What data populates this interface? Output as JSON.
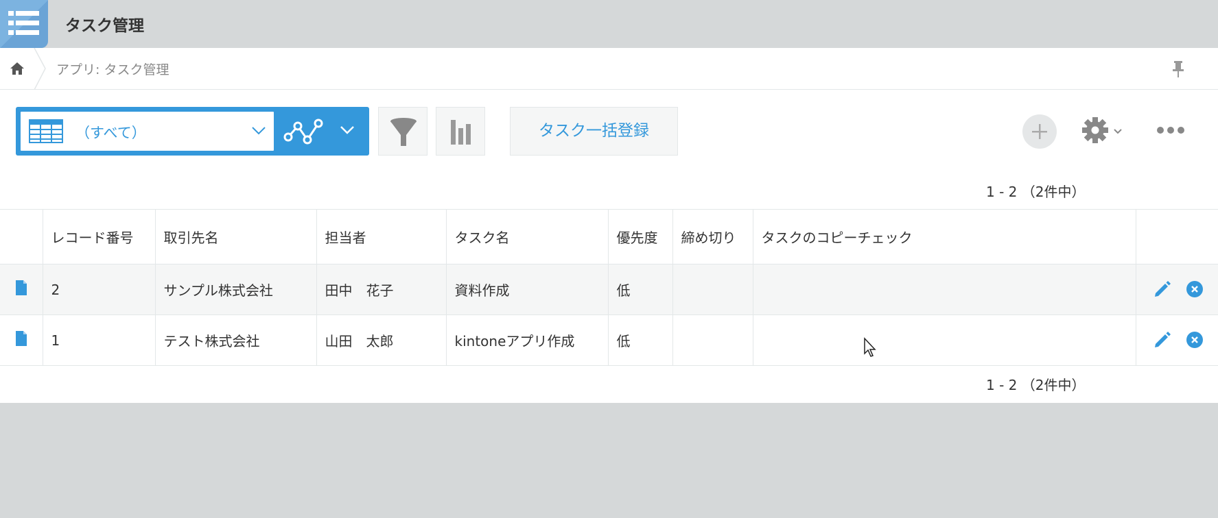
{
  "header": {
    "app_title": "タスク管理",
    "app_icon": "list-icon"
  },
  "breadcrumb": {
    "home_icon": "home-icon",
    "text": "アプリ: タスク管理",
    "pin_icon": "pin-icon"
  },
  "toolbar": {
    "view_label": "（すべて）",
    "view_icon": "table-view-icon",
    "graph_icon": "line-graph-icon",
    "filter_icon": "filter-icon",
    "chart_icon": "bar-chart-icon",
    "bulk_button": "タスク一括登録",
    "add_icon": "plus-icon",
    "settings_icon": "gear-icon",
    "more_icon": "more-dots-icon"
  },
  "pager": {
    "top": "1 - 2 （2件中）",
    "bottom": "1 - 2 （2件中）"
  },
  "table": {
    "columns": [
      "レコード番号",
      "取引先名",
      "担当者",
      "タスク名",
      "優先度",
      "締め切り",
      "タスクのコピーチェック"
    ],
    "rows": [
      {
        "record_no": "2",
        "client": "サンプル株式会社",
        "assignee": "田中　花子",
        "task": "資料作成",
        "priority": "低",
        "deadline": "",
        "copy_check": ""
      },
      {
        "record_no": "1",
        "client": "テスト株式会社",
        "assignee": "山田　太郎",
        "task": "kintoneアプリ作成",
        "priority": "低",
        "deadline": "",
        "copy_check": ""
      }
    ]
  },
  "colors": {
    "accent": "#3498db",
    "background": "#d5d8d9",
    "row_shade": "#f5f6f6"
  }
}
